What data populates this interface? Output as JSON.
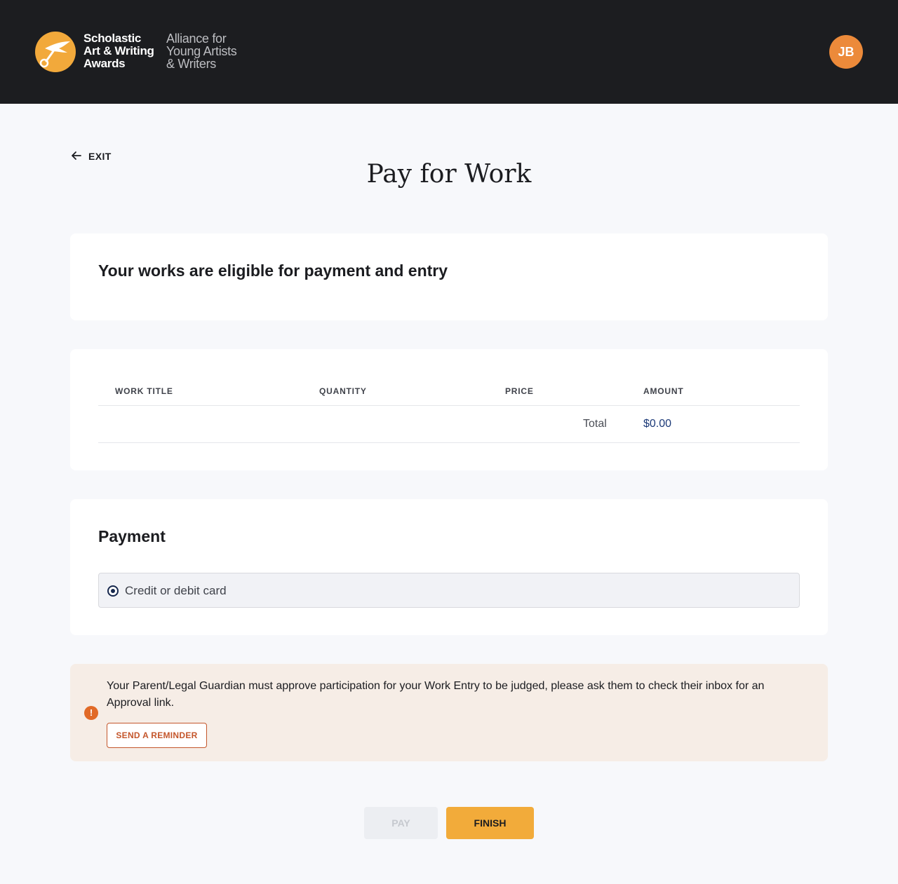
{
  "header": {
    "brand_line1": "Scholastic",
    "brand_line2": "Art & Writing",
    "brand_line3": "Awards",
    "tag_line1": "Alliance for",
    "tag_line2": "Young Artists",
    "tag_line3": "& Writers",
    "avatar_initials": "JB"
  },
  "nav": {
    "exit_label": "EXIT"
  },
  "page": {
    "title": "Pay for Work"
  },
  "eligibility": {
    "heading": "Your works are eligible for payment and entry"
  },
  "table": {
    "columns": [
      "WORK TITLE",
      "QUANTITY",
      "PRICE",
      "AMOUNT"
    ],
    "total_label": "Total",
    "total_amount": "$0.00"
  },
  "payment": {
    "heading": "Payment",
    "option_label": "Credit or debit card",
    "option_selected": true
  },
  "alert": {
    "icon": "exclamation-icon",
    "message": "Your Parent/Legal Guardian must approve participation for your Work Entry to be judged, please ask them to check their inbox for an Approval link.",
    "reminder_label": "SEND A REMINDER"
  },
  "actions": {
    "pay_label": "PAY",
    "finish_label": "FINISH"
  },
  "colors": {
    "header_bg": "#1c1d20",
    "accent_orange": "#f2ab3a",
    "avatar_bg": "#ec8a3a",
    "alert_bg": "#f6ede6",
    "alert_accent": "#c4562b"
  }
}
